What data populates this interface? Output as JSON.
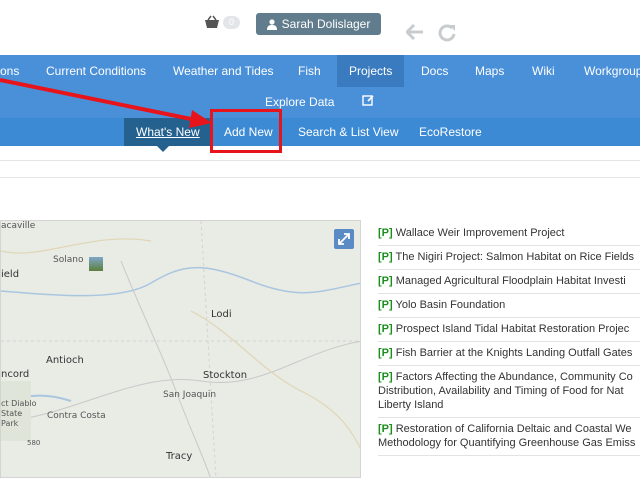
{
  "header": {
    "cart_count": "0",
    "user_name": "Sarah Dolislager",
    "icons": [
      "shopping-basket-icon",
      "user-icon",
      "back-arrow-icon",
      "refresh-icon"
    ]
  },
  "nav": {
    "items": [
      "ons",
      "Current Conditions",
      "Weather and Tides",
      "Fish",
      "Projects",
      "Docs",
      "Maps",
      "Wiki",
      "Workgroup"
    ],
    "active": "Projects",
    "second_row": {
      "explore": "Explore Data",
      "edit_icon": "edit-icon"
    },
    "sub_items": [
      "What's New",
      "Add New",
      "Search & List View",
      "EcoRestore"
    ],
    "sub_active": "What's New"
  },
  "annotation": {
    "arrow_color": "#e8141b",
    "highlight": "Add New"
  },
  "map": {
    "labels": [
      "acaville",
      "Solano",
      "ield",
      "Lodi",
      "Antioch",
      "ncord",
      "Stockton",
      "San Joaquin",
      "Contra Costa",
      "ct Diablo State Park",
      "Tracy",
      "580"
    ],
    "expand_icon": "expand-icon"
  },
  "projects": [
    {
      "tag": "[P]",
      "title": "Wallace Weir Improvement Project"
    },
    {
      "tag": "[P]",
      "title": "The Nigiri Project: Salmon Habitat on Rice Fields"
    },
    {
      "tag": "[P]",
      "title": "Managed Agricultural Floodplain Habitat Investi"
    },
    {
      "tag": "[P]",
      "title": "Yolo Basin Foundation"
    },
    {
      "tag": "[P]",
      "title": "Prospect Island Tidal Habitat Restoration Projec"
    },
    {
      "tag": "[P]",
      "title": "Fish Barrier at the Knights Landing Outfall Gates"
    },
    {
      "tag": "[P]",
      "title": "Factors Affecting the Abundance, Community Co Distribution, Availability and Timing of Food for Nat Liberty Island"
    },
    {
      "tag": "[P]",
      "title": "Restoration of California Deltaic and Coastal We Methodology for Quantifying Greenhouse Gas Emiss"
    }
  ]
}
